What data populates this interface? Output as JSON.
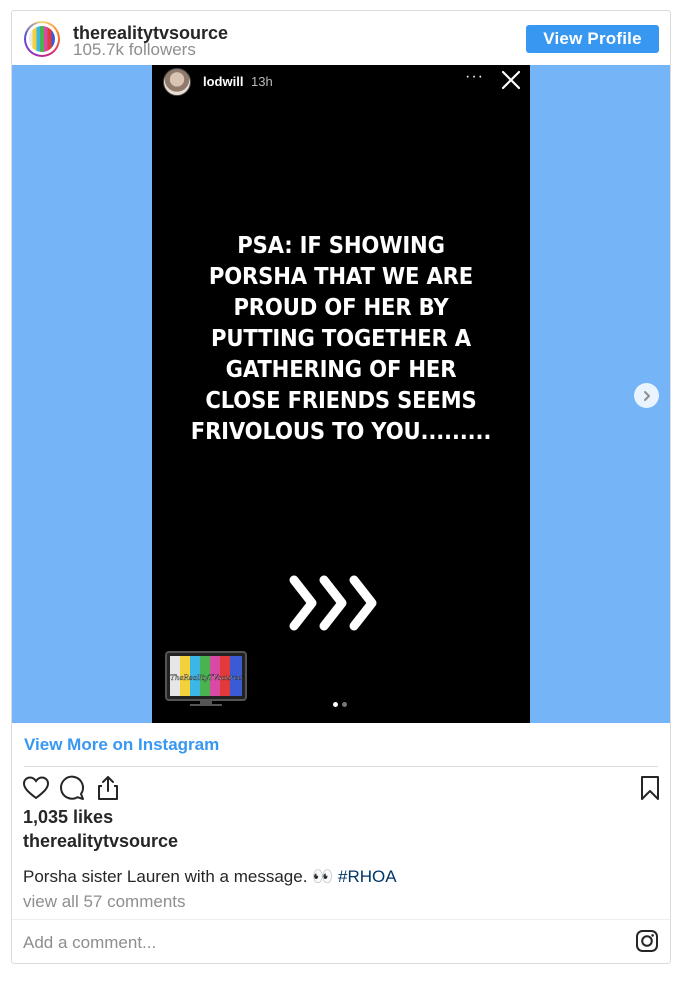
{
  "header": {
    "account_name": "therealitytvsource",
    "followers": "105.7k followers",
    "view_profile_label": "View Profile"
  },
  "story": {
    "username": "lodwill",
    "time": "13h",
    "more_label": "···",
    "text": "PSA: IF SHOWING PORSHA THAT WE ARE PROUD OF HER BY PUTTING TOGETHER A GATHERING OF HER CLOSE FRIENDS SEEMS FRIVOLOUS TO YOU.........",
    "logo_text": "TheRealityTVsource",
    "slide_count": 2,
    "active_slide": 1
  },
  "footer": {
    "view_more_label": "View More on Instagram",
    "likes": "1,035 likes",
    "caption_user": "therealitytvsource",
    "caption_text": "Porsha sister Lauren with a message. 👀 ",
    "caption_hashtag": "#RHOA",
    "view_comments": "view all 57 comments",
    "add_comment_placeholder": "Add a comment..."
  },
  "icons": {
    "like": "heart-icon",
    "comment": "comment-icon",
    "share": "share-icon",
    "save": "bookmark-icon",
    "instagram": "instagram-icon",
    "next": "chevron-right-icon",
    "close": "close-icon"
  },
  "colors": {
    "accent": "#3897f0",
    "media_background": "#75b4f7",
    "hashtag": "#003569"
  }
}
